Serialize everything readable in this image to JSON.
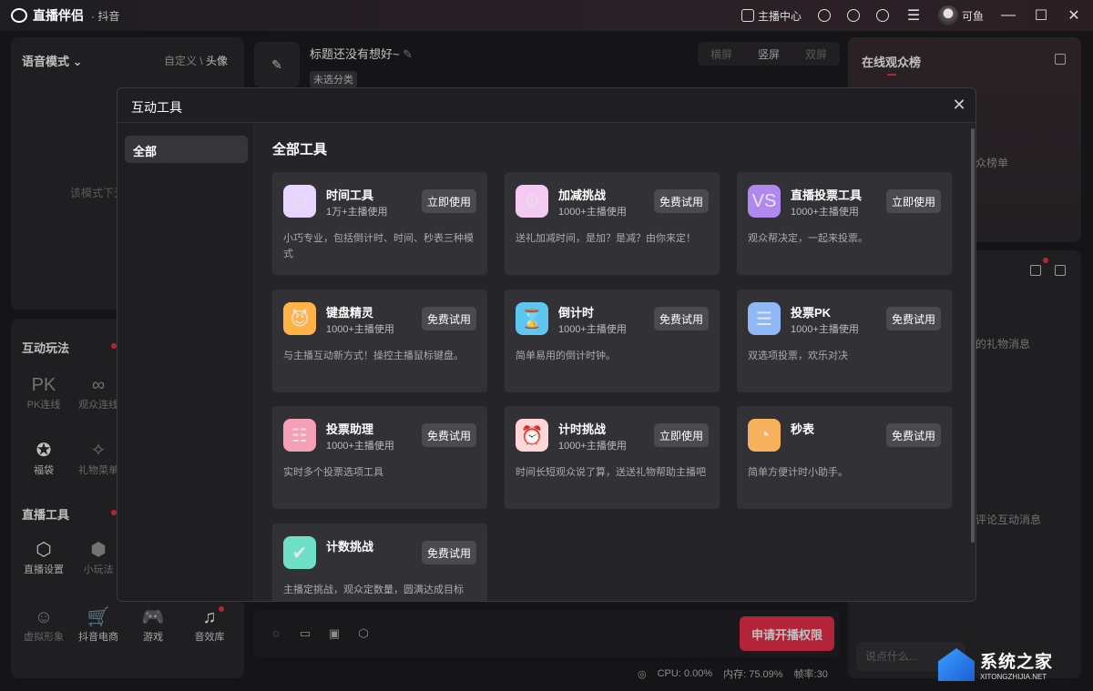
{
  "titlebar": {
    "app_name": "直播伴侣",
    "app_sub": "· 抖音",
    "anchor_center": "主播中心",
    "username": "可鱼",
    "min": "—",
    "max": "☐",
    "close": "✕"
  },
  "left_top": {
    "title": "语音模式",
    "link_custom": "自定义",
    "sep": "\\",
    "link_avatar": "头像",
    "hint": "该模式下无"
  },
  "left_bottom": {
    "section_interact": "互动玩法",
    "interact_items": [
      {
        "label": "PK连线",
        "glyph": "PK"
      },
      {
        "label": "观众连线",
        "glyph": "∞"
      },
      {
        "label": "福袋",
        "glyph": "✪"
      },
      {
        "label": "礼物菜单",
        "glyph": "✧"
      }
    ],
    "section_tools": "直播工具",
    "tool_items": [
      {
        "label": "直播设置",
        "glyph": "⬡"
      },
      {
        "label": "小玩法",
        "glyph": "⬢"
      },
      {
        "label": "虚拟形象",
        "glyph": "☺"
      },
      {
        "label": "抖音电商",
        "glyph": "🛒"
      },
      {
        "label": "游戏",
        "glyph": "🎮"
      },
      {
        "label": "音效库",
        "glyph": "♫"
      }
    ]
  },
  "center": {
    "title": "标题还没有想好~",
    "tag": "未选分类",
    "modes": [
      "横屏",
      "竖屏",
      "双屏"
    ]
  },
  "right": {
    "rank_title": "在线观众榜",
    "rank_text": "众榜单",
    "gift_text": "的礼物消息",
    "comment_text": "评论互动消息",
    "chat_placeholder": "说点什么..."
  },
  "bottom": {
    "apply_button": "申请开播权限",
    "cpu": "CPU: 0.00%",
    "memory": "内存: 75.09%",
    "fps": "帧率:30"
  },
  "watermark": {
    "main": "系统之家",
    "sub": "XITONGZHIJIA.NET"
  },
  "modal": {
    "title": "互动工具",
    "side_item": "全部",
    "main_title": "全部工具",
    "close_glyph": "✕",
    "cards": [
      {
        "name": "时间工具",
        "users": "1万+主播使用",
        "button": "立即使用",
        "desc": "小巧专业，包括倒计时、时间、秒表三种模式",
        "icon": "⏱",
        "color": "#e7d5ff"
      },
      {
        "name": "加减挑战",
        "users": "1000+主播使用",
        "button": "免费试用",
        "desc": "送礼加减时间，是加？是减？由你来定！",
        "icon": "⏲",
        "color": "#f4c9f2"
      },
      {
        "name": "直播投票工具",
        "users": "1000+主播使用",
        "button": "立即使用",
        "desc": "观众帮决定，一起来投票。",
        "icon": "VS",
        "color": "#b088f0"
      },
      {
        "name": "键盘精灵",
        "users": "1000+主播使用",
        "button": "免费试用",
        "desc": "与主播互动新方式！操控主播鼠标键盘。",
        "icon": "😈",
        "color": "#ffb347"
      },
      {
        "name": "倒计时",
        "users": "1000+主播使用",
        "button": "免费试用",
        "desc": "简单易用的倒计时钟。",
        "icon": "⌛",
        "color": "#5ec6f0"
      },
      {
        "name": "投票PK",
        "users": "1000+主播使用",
        "button": "免费试用",
        "desc": "双选项投票，欢乐对决",
        "icon": "☰",
        "color": "#8fb8f5"
      },
      {
        "name": "投票助理",
        "users": "1000+主播使用",
        "button": "免费试用",
        "desc": "实时多个投票选项工具",
        "icon": "☷",
        "color": "#f6a0b8"
      },
      {
        "name": "计时挑战",
        "users": "1000+主播使用",
        "button": "立即使用",
        "desc": "时间长短观众说了算，送送礼物帮助主播吧",
        "icon": "⏰",
        "color": "#ffd6d6"
      },
      {
        "name": "秒表",
        "users": "",
        "button": "免费试用",
        "desc": "简单方便计时小助手。",
        "icon": "◔",
        "color": "#f7b15c"
      },
      {
        "name": "计数挑战",
        "users": "",
        "button": "免费试用",
        "desc": "主播定挑战，观众定数量，圆满达成目标",
        "icon": "✔",
        "color": "#6fe0c8"
      }
    ]
  }
}
